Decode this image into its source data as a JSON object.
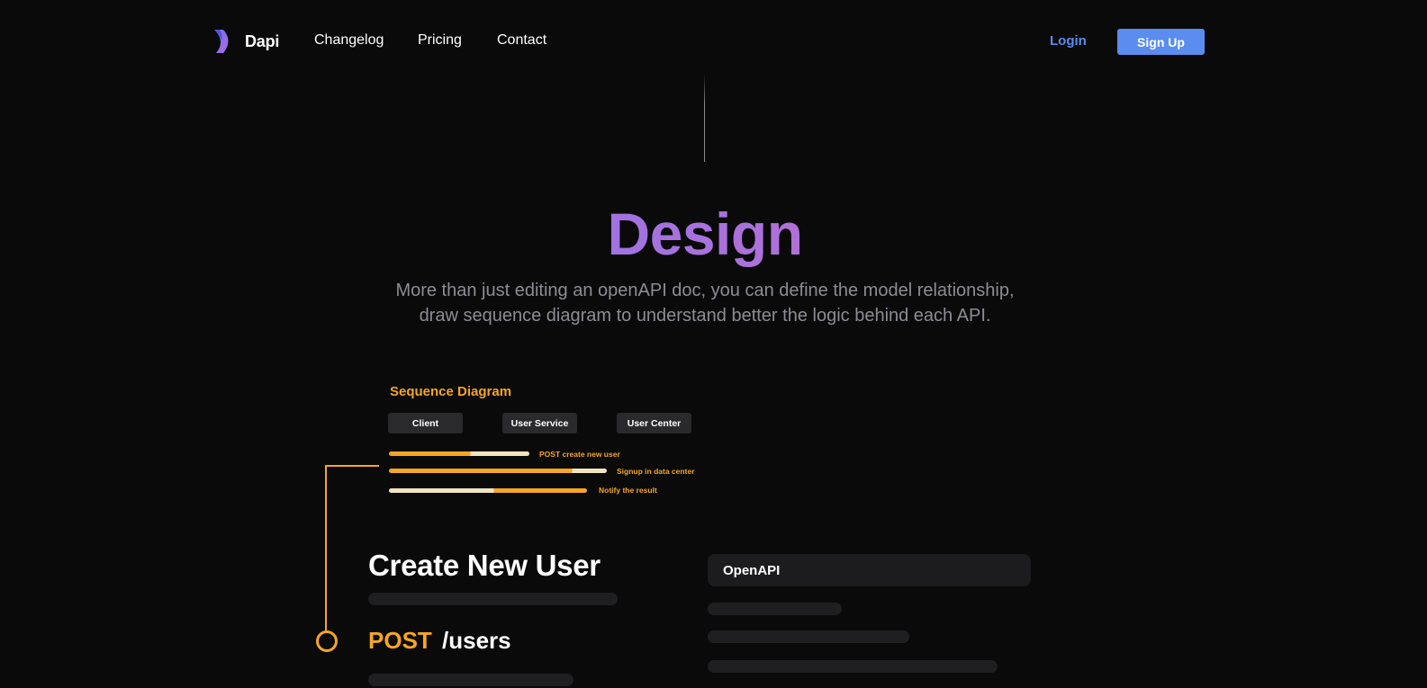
{
  "nav": {
    "brand": "Dapi",
    "logo_icon": "dapi-logo-icon",
    "links": [
      "Changelog",
      "Pricing",
      "Contact"
    ],
    "login": "Login",
    "signup": "Sign Up",
    "accent_color": "#5b8dee"
  },
  "hero": {
    "title": "Design",
    "subtitle_line1": "More than just editing an openAPI doc, you can define the model relationship,",
    "subtitle_line2": "draw sequence diagram to understand better the logic behind each API."
  },
  "sequence": {
    "title": "Sequence Diagram",
    "actors": [
      "Client",
      "User Service",
      "User Center"
    ],
    "messages": [
      "POST create new user",
      "Signup in data center",
      "Notify the result"
    ],
    "accent_color": "#f5a623"
  },
  "endpoint": {
    "title": "Create New User",
    "method": "POST",
    "path": "/users"
  },
  "openapi": {
    "label": "OpenAPI"
  }
}
